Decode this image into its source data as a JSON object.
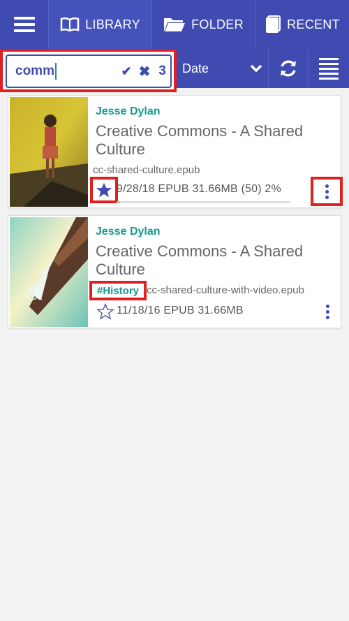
{
  "nav": {
    "tabs": [
      {
        "label": "LIBRARY",
        "icon": "book-icon"
      },
      {
        "label": "FOLDER",
        "icon": "folder-icon"
      },
      {
        "label": "RECENT",
        "icon": "document-icon"
      }
    ]
  },
  "search": {
    "value": "comm",
    "result_count": "3"
  },
  "sort": {
    "selected": "Date"
  },
  "books": [
    {
      "author": "Jesse Dylan",
      "title": "Creative Commons - A Shared Culture",
      "filename": "cc-shared-culture.epub",
      "meta": "9/28/18  EPUB  31.66MB (50)  2%",
      "progress": 0.02,
      "starred": true
    },
    {
      "author": "Jesse Dylan",
      "title": "Creative Commons - A Shared Culture",
      "tag": "#History",
      "filename": "cc-shared-culture-with-video.epub",
      "meta": "11/18/16  EPUB  31.66MB",
      "starred": false
    }
  ],
  "colors": {
    "primary": "#3f4bb1",
    "accent": "#139c8f",
    "highlight": "#e02020"
  }
}
